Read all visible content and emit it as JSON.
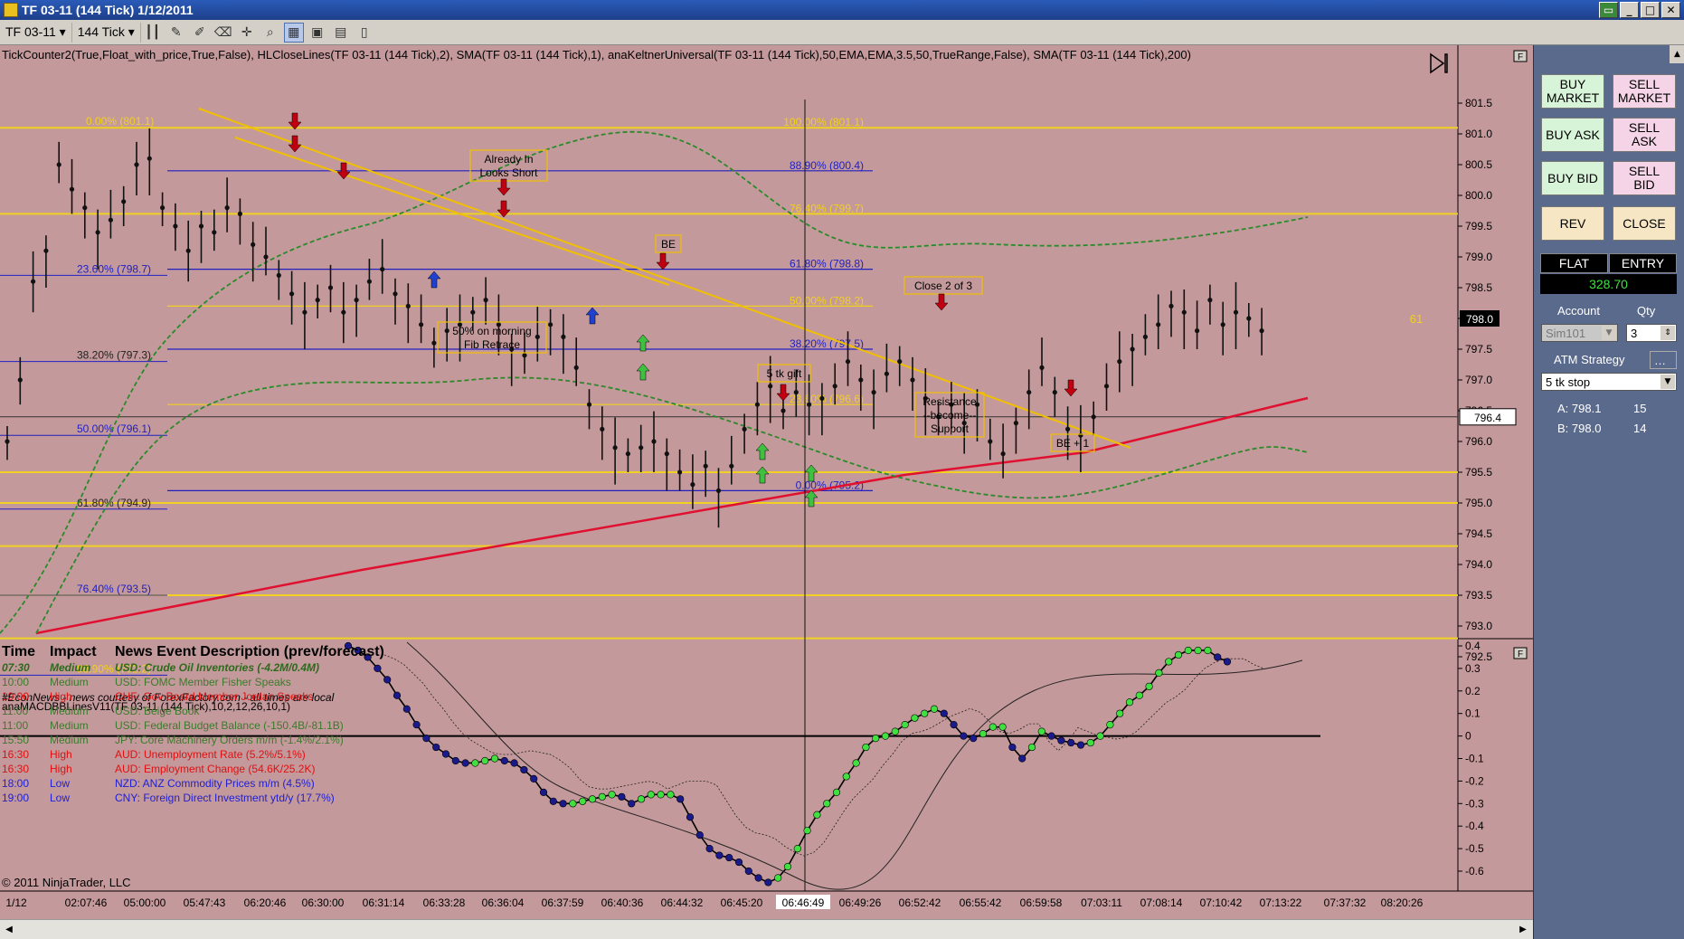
{
  "window": {
    "title": "TF 03-11 (144 Tick)  1/12/2011",
    "restore_icon": "restore-icon",
    "minimize": "_",
    "maximize": "□",
    "close": "✕"
  },
  "toolbar": {
    "instrument": "TF 03-11 ▾",
    "interval": "144 Tick ▾",
    "icons": [
      "bars-icon",
      "pencil-icon",
      "draw-icon",
      "crosshair-icon",
      "zoom-icon",
      "tile-icon",
      "layout-icon",
      "properties-icon",
      "data-box-icon"
    ]
  },
  "indicators_label": "TickCounter2(True,Float_with_price,True,False),  HLCloseLines(TF 03-11 (144 Tick),2),  SMA(TF 03-11 (144 Tick),1),  anaKeltnerUniversal(TF 03-11 (144 Tick),50,EMA,EMA,3.5,50,TrueRange,False),  SMA(TF 03-11 (144 Tick),200)",
  "price_axis": [
    "801.5",
    "801.0",
    "800.5",
    "800.0",
    "799.5",
    "799.0",
    "798.5",
    "798.0",
    "797.5",
    "797.0",
    "796.5",
    "796.0",
    "795.5",
    "795.0",
    "794.5",
    "794.0",
    "793.5",
    "793.0",
    "792.5"
  ],
  "last_price": "798.0",
  "cursor_price": "796.4",
  "tick_counter": "61",
  "osc_axis": [
    "0.4",
    "0.3",
    "0.2",
    "0.1",
    "0",
    "-0.1",
    "-0.2",
    "-0.3",
    "-0.4",
    "-0.5",
    "-0.6"
  ],
  "time_axis": [
    "1/12",
    "02:07:46",
    "05:00:00",
    "05:47:43",
    "06:20:46",
    "06:30:00",
    "06:31:14",
    "06:33:28",
    "06:36:04",
    "06:37:59",
    "06:40:36",
    "06:44:32",
    "06:45:20",
    "06:46:49",
    "06:49:26",
    "06:52:42",
    "06:55:42",
    "06:59:58",
    "07:03:11",
    "07:08:14",
    "07:10:42",
    "07:13:22",
    "07:37:32",
    "08:20:26"
  ],
  "fib_left": [
    {
      "label": "0.00% (801.1)"
    },
    {
      "label": "23.60% (798.7)"
    },
    {
      "label": "38.20% (797.3)"
    },
    {
      "label": "50.00% (796.1)"
    },
    {
      "label": "61.80% (794.9)"
    },
    {
      "label": "76.40% (793.5)"
    },
    {
      "label": "88.90% (792.2)"
    }
  ],
  "fib_mid": [
    {
      "label": "100.00% (801.1)"
    },
    {
      "label": "88.90% (800.4)"
    },
    {
      "label": "76.40% (799.7)"
    },
    {
      "label": "61.80% (798.8)"
    },
    {
      "label": "50.00% (798.2)"
    },
    {
      "label": "38.20% (797.5)"
    },
    {
      "label": "23.60% (796.6)"
    },
    {
      "label": "0.00% (795.2)"
    }
  ],
  "annotations": [
    "Already In\nLooks Short",
    "BE",
    "50% on morning\nFib Retrace",
    "5 tk gift",
    "Close 2 of 3",
    "Resistance\n--become--\nSupport",
    "BE + 1"
  ],
  "news": {
    "credit": "#EconNews - news courtesy of ForexFactory.com - all times are local",
    "overlay_label": "anaMACDBBLinesV11(TF 03-11 (144 Tick),10,2,12,26,10,1)",
    "headers": [
      "Time",
      "Impact",
      "News Event Description (prev/forecast)"
    ],
    "rows": [
      {
        "time": "07:30",
        "impact": "Medium",
        "desc": "USD: Crude Oil Inventories (-4.2M/0.4M)",
        "color": "#2c6a1c"
      },
      {
        "time": "10:00",
        "impact": "Medium",
        "desc": "USD: FOMC Member Fisher Speaks",
        "color": "#3c7a2c"
      },
      {
        "time": "10:00",
        "impact": "High",
        "desc": "CHF: Gov Board Member Jordan Speaks",
        "color": "#e01010"
      },
      {
        "time": "11:00",
        "impact": "Medium",
        "desc": "USD: Beige Book",
        "color": "#3c7a2c"
      },
      {
        "time": "11:00",
        "impact": "Medium",
        "desc": "USD: Federal Budget Balance (-150.4B/-81.1B)",
        "color": "#3c7a2c"
      },
      {
        "time": "15:50",
        "impact": "Medium",
        "desc": "JPY: Core Machinery Orders m/m (-1.4%/2.1%)",
        "color": "#3c7a2c"
      },
      {
        "time": "16:30",
        "impact": "High",
        "desc": "AUD: Unemployment Rate (5.2%/5.1%)",
        "color": "#e01010"
      },
      {
        "time": "16:30",
        "impact": "High",
        "desc": "AUD: Employment Change (54.6K/25.2K)",
        "color": "#e01010"
      },
      {
        "time": "18:00",
        "impact": "Low",
        "desc": "NZD: ANZ Commodity Prices m/m (4.5%)",
        "color": "#2020d0"
      },
      {
        "time": "19:00",
        "impact": "Low",
        "desc": "CNY: Foreign Direct Investment ytd/y (17.7%)",
        "color": "#2020d0"
      }
    ]
  },
  "copyright": "© 2011 NinjaTrader, LLC",
  "panel": {
    "buy_market": "BUY\nMARKET",
    "sell_market": "SELL\nMARKET",
    "buy_ask": "BUY ASK",
    "sell_ask": "SELL\nASK",
    "buy_bid": "BUY BID",
    "sell_bid": "SELL\nBID",
    "rev": "REV",
    "close": "CLOSE",
    "position": "FLAT",
    "entry": "ENTRY",
    "pnl": "328.70",
    "account_label": "Account",
    "qty_label": "Qty",
    "account": "Sim101",
    "qty": "3",
    "atm_label": "ATM Strategy",
    "atm_value": "5 tk stop",
    "ask_label": "A: 798.1",
    "ask_size": "15",
    "bid_label": "B: 798.0",
    "bid_size": "14"
  },
  "colors": {
    "chart_bg": "#c4999b",
    "fib": "#f0d020",
    "fib_blue": "#2020c0",
    "keltner": "#2a8a2a",
    "sma200": "#e01030",
    "trend": "#f0c000"
  }
}
